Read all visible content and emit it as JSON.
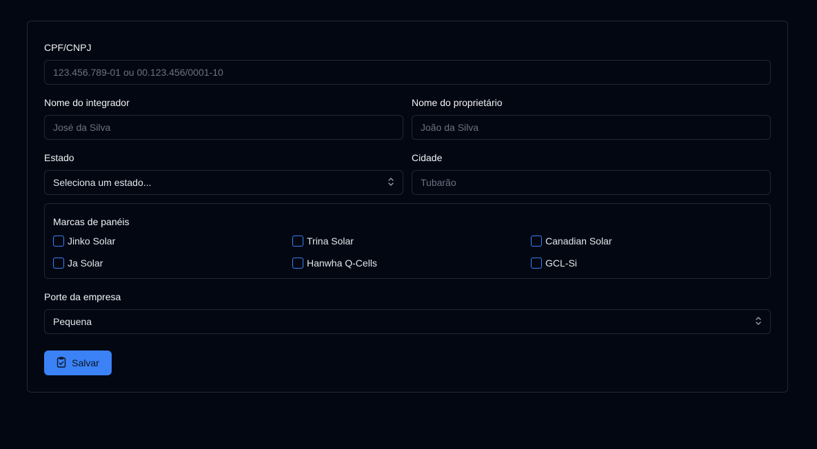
{
  "form": {
    "cpf": {
      "label": "CPF/CNPJ",
      "placeholder": "123.456.789-01 ou 00.123.456/0001-10"
    },
    "integrator": {
      "label": "Nome do integrador",
      "placeholder": "José da Silva"
    },
    "owner": {
      "label": "Nome do proprietário",
      "placeholder": "João da Silva"
    },
    "state": {
      "label": "Estado",
      "value": "Seleciona um estado..."
    },
    "city": {
      "label": "Cidade",
      "placeholder": "Tubarão"
    },
    "brands": {
      "title": "Marcas de panéis",
      "items": [
        "Jinko Solar",
        "Trina Solar",
        "Canadian Solar",
        "Ja Solar",
        "Hanwha Q-Cells",
        "GCL-Si"
      ]
    },
    "size": {
      "label": "Porte da empresa",
      "value": "Pequena"
    },
    "save_label": "Salvar"
  },
  "colors": {
    "accent": "#3b82f6",
    "background": "#030712",
    "border": "#1f2937"
  }
}
